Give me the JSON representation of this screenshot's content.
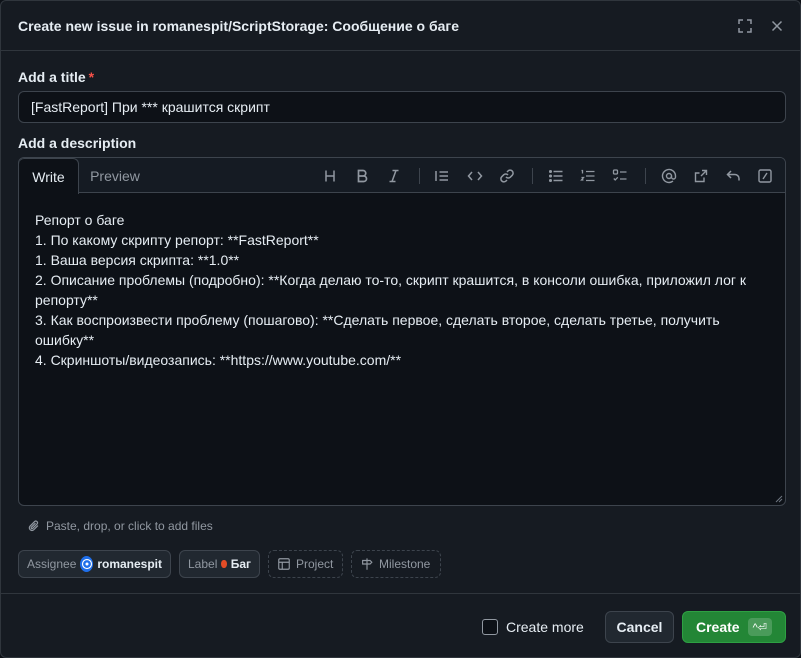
{
  "dialog": {
    "title": "Create new issue in romanespit/ScriptStorage: Сообщение о баге"
  },
  "title_field": {
    "label": "Add a title",
    "required_mark": "*",
    "value": "[FastReport] При *** крашится скрипт"
  },
  "description": {
    "label": "Add a description",
    "tabs": {
      "write": "Write",
      "preview": "Preview"
    },
    "toolbar_icons": [
      "heading-icon",
      "bold-icon",
      "italic-icon",
      "quote-icon",
      "code-icon",
      "link-icon",
      "bulleted-list-icon",
      "numbered-list-icon",
      "task-list-icon",
      "mention-icon",
      "reference-icon",
      "reply-icon",
      "slash-command-icon"
    ],
    "body": "Репорт о баге\n1. По какому скрипту репорт: **FastReport**\n1. Ваша версия скрипта: **1.0**\n2. Описание проблемы (подробно): **Когда делаю то-то, скрипт крашится, в консоли ошибка, приложил лог к репорту**\n3. Как воспроизвести проблему (пошагово): **Сделать первое, сделать второе, сделать третье, получить ошибку**\n4. Скриншоты/видеозапись: **https://www.youtube.com/**"
  },
  "attach_hint": "Paste, drop, or click to add files",
  "metadata": {
    "assignee_label": "Assignee",
    "assignee_value": "romanespit",
    "label_label": "Label",
    "label_value": "Баг",
    "label_color": "#e34c26",
    "project_label": "Project",
    "milestone_label": "Milestone"
  },
  "footer": {
    "create_more": "Create more",
    "cancel": "Cancel",
    "create": "Create",
    "shortcut": "^⏎"
  },
  "colors": {
    "primary_button": "#238636",
    "background": "#161b22",
    "editor_background": "#0d1117"
  }
}
